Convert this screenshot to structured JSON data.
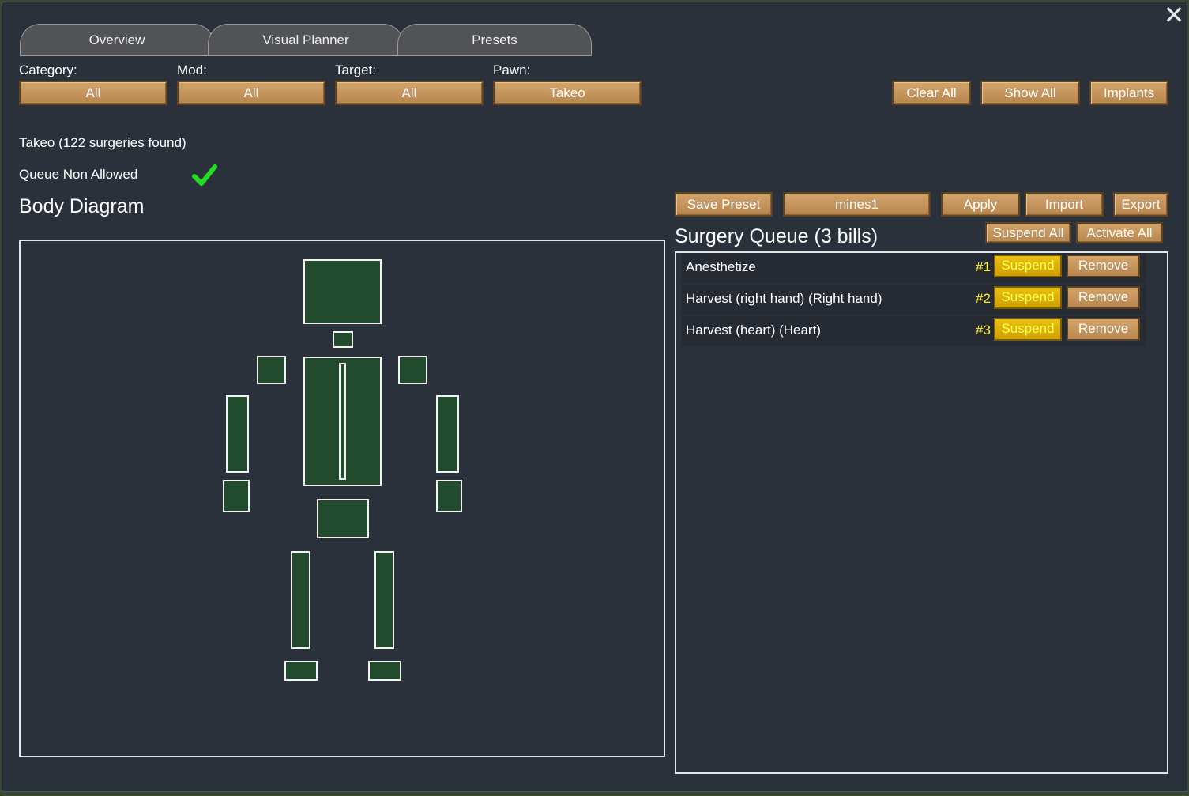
{
  "tabs": [
    "Overview",
    "Visual Planner",
    "Presets"
  ],
  "filters": {
    "category_label": "Category:",
    "category_value": "All",
    "mod_label": "Mod:",
    "mod_value": "All",
    "target_label": "Target:",
    "target_value": "All",
    "pawn_label": "Pawn:",
    "pawn_value": "Takeo"
  },
  "toolbar": {
    "clear_all": "Clear All",
    "show_all": "Show All",
    "implants": "Implants"
  },
  "status": {
    "found_text": "Takeo (122 surgeries found)",
    "queue_non_allowed": "Queue Non Allowed"
  },
  "body_diagram": {
    "title": "Body Diagram"
  },
  "presets": {
    "save": "Save Preset",
    "name": "mines1",
    "apply": "Apply",
    "import": "Import",
    "export": "Export"
  },
  "queue": {
    "title": "Surgery Queue (3 bills)",
    "suspend_all": "Suspend All",
    "activate_all": "Activate All",
    "suspend_label": "Suspend",
    "remove_label": "Remove",
    "bills": [
      {
        "name": "Anesthetize",
        "num": "#1"
      },
      {
        "name": "Harvest (right hand) (Right hand)",
        "num": "#2"
      },
      {
        "name": "Harvest (heart) (Heart)",
        "num": "#3"
      }
    ]
  },
  "colors": {
    "button": "#c89a5e",
    "suspend": "#e2b600",
    "bodypart": "#224a2c",
    "check": "#22dd22"
  }
}
